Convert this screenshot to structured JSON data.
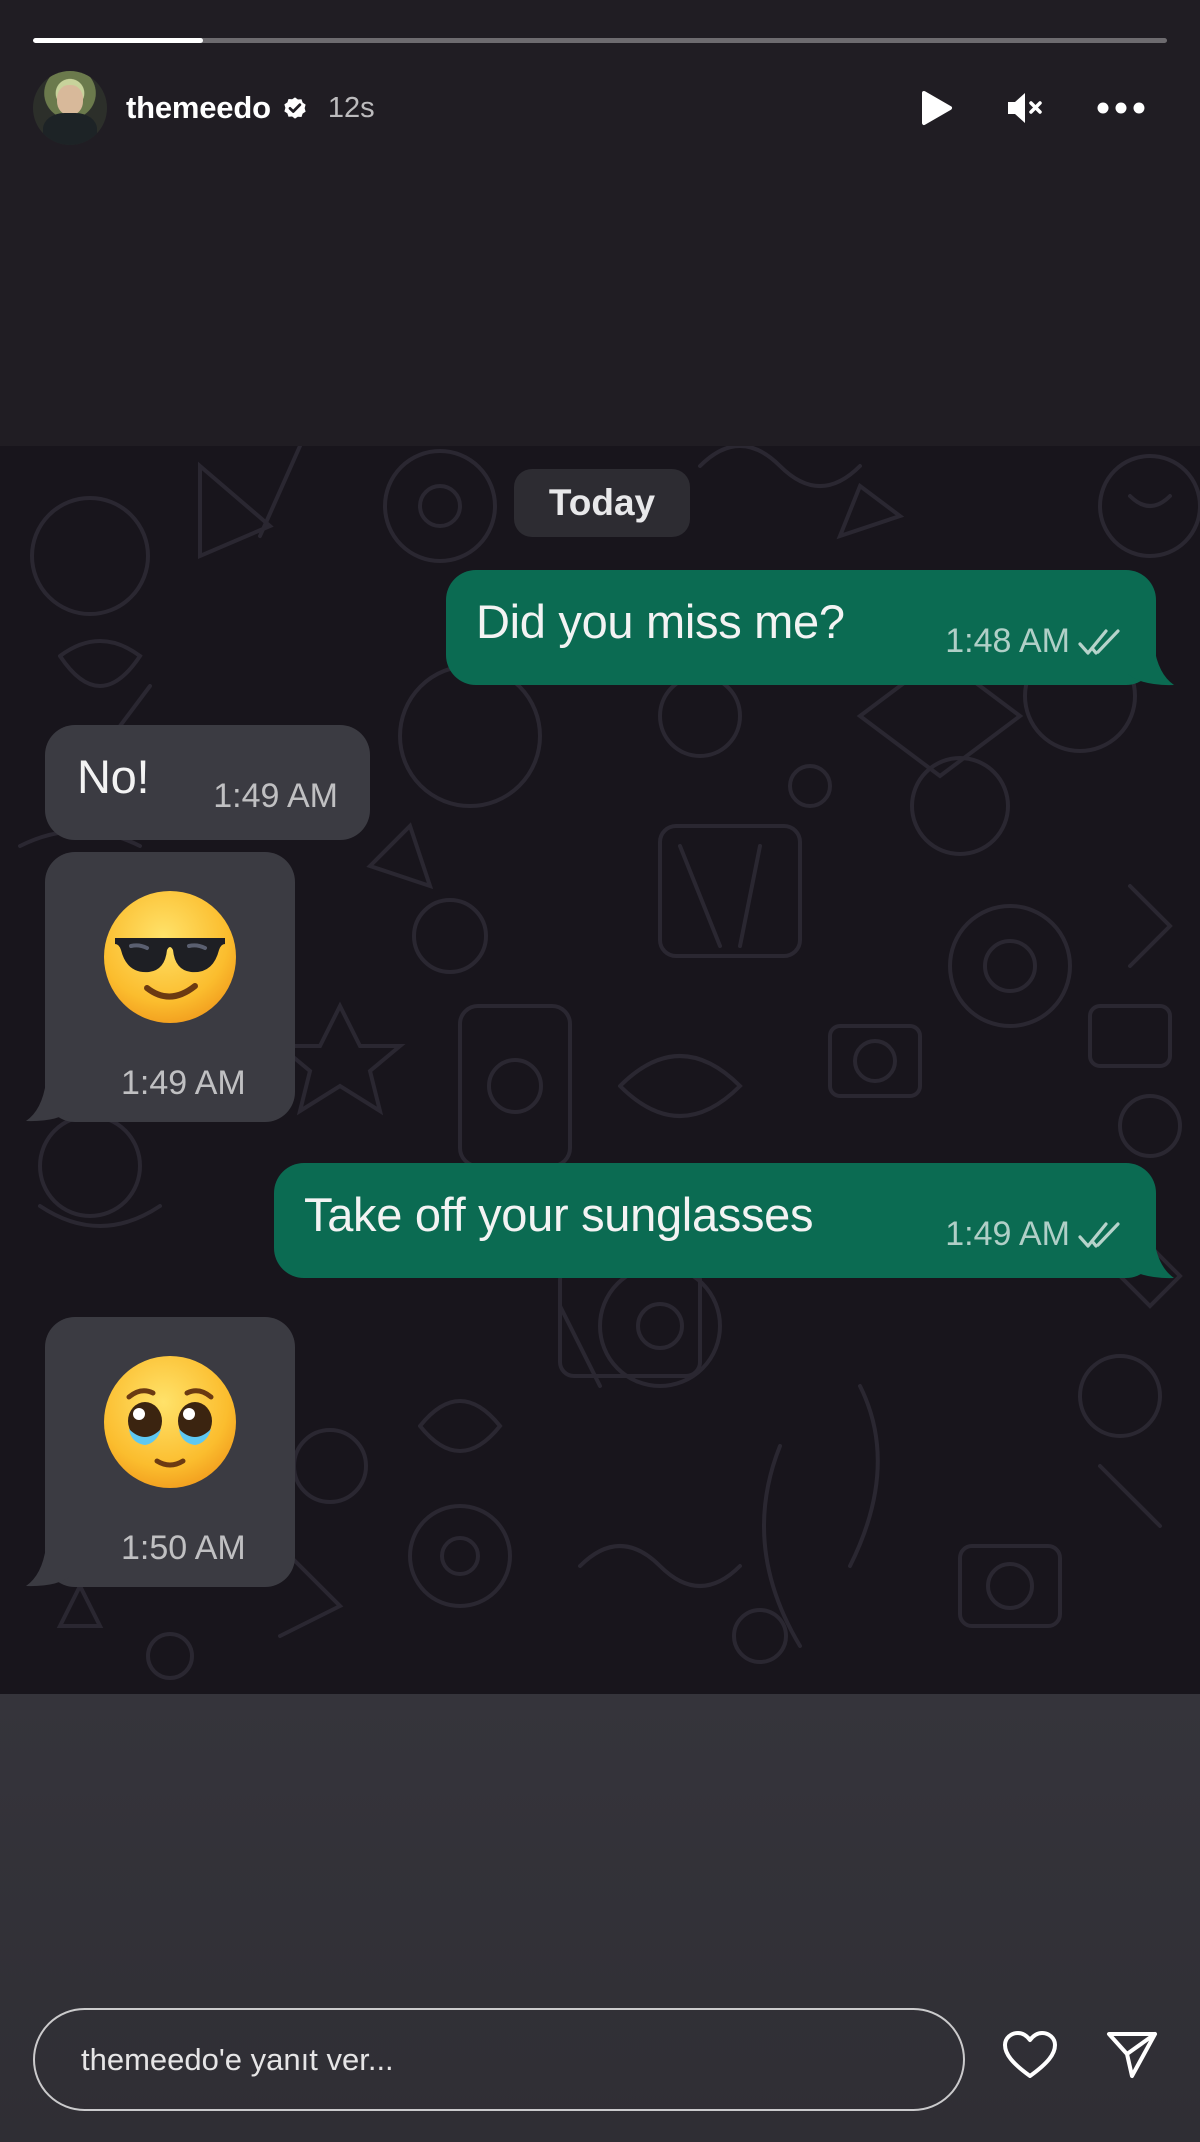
{
  "story": {
    "progress": 0.15,
    "username": "themeedo",
    "time_ago": "12s",
    "icons": {
      "verified": "verified-badge-icon",
      "play": "play-icon",
      "mute": "speaker-muted-icon",
      "more": "more-options-icon"
    }
  },
  "chat": {
    "date_label": "Today",
    "messages": [
      {
        "direction": "outgoing",
        "text": "Did you miss me?",
        "time": "1:48 AM",
        "read": true
      },
      {
        "direction": "incoming",
        "text": "No!",
        "time": "1:49 AM"
      },
      {
        "direction": "incoming",
        "emoji": "smiling face with sunglasses",
        "time": "1:49 AM"
      },
      {
        "direction": "outgoing",
        "text": "Take off your sunglasses",
        "time": "1:49 AM",
        "read": true
      },
      {
        "direction": "incoming",
        "emoji": "face holding back tears",
        "time": "1:50 AM"
      }
    ],
    "colors": {
      "outgoing": "#0b6b52",
      "incoming": "#3b3b42",
      "background": "#18151c"
    }
  },
  "reply": {
    "placeholder": "themeedo'e yanıt ver...",
    "icons": {
      "like": "heart-icon",
      "send": "send-icon"
    }
  }
}
